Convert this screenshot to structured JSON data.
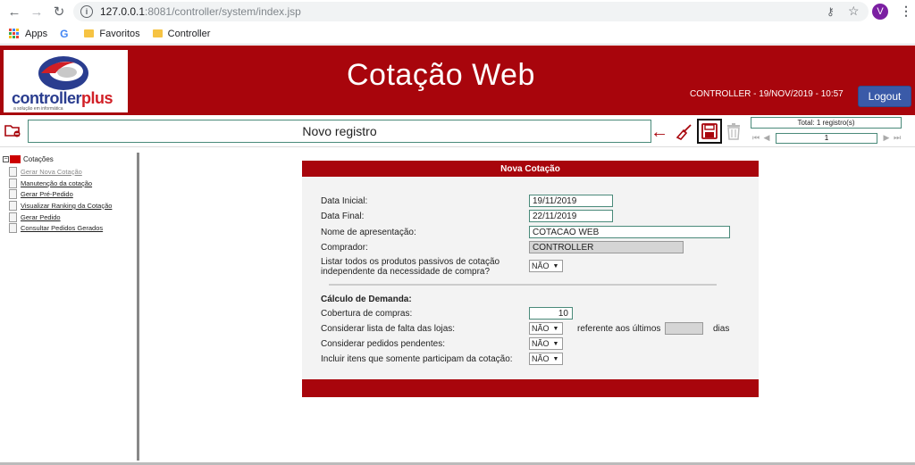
{
  "browser": {
    "url_host": "127.0.0.1",
    "url_path": ":8081/controller/system/index.jsp",
    "avatar_letter": "V",
    "bookmarks": [
      "Apps",
      "Favoritos",
      "Controller"
    ]
  },
  "header": {
    "logo_text_1": "controller",
    "logo_text_2": "plus",
    "logo_tagline": "a solução em informática",
    "title": "Cotação Web",
    "user_info": "CONTROLLER - 19/NOV/2019 - 10:57",
    "logout_label": "Logout",
    "brand_color": "#a8050c"
  },
  "toolbar": {
    "record_label": "Novo registro",
    "total_label": "Total: 1 registro(s)",
    "current_page": "1"
  },
  "sidebar": {
    "root_label": "Cotações",
    "items": [
      {
        "label": "Gerar Nova Cotação"
      },
      {
        "label": "Manutenção da cotação"
      },
      {
        "label": "Gerar Pré-Pedido"
      },
      {
        "label": "Visualizar Ranking da Cotação"
      },
      {
        "label": "Gerar Pedido"
      },
      {
        "label": "Consultar Pedidos Gerados"
      }
    ]
  },
  "form": {
    "title": "Nova Cotação",
    "data_inicial_label": "Data Inicial:",
    "data_inicial_value": "19/11/2019",
    "data_final_label": "Data Final:",
    "data_final_value": "22/11/2019",
    "nome_label": "Nome de apresentação:",
    "nome_value": "COTACAO WEB",
    "comprador_label": "Comprador:",
    "comprador_value": "CONTROLLER",
    "listar_label_1": "Listar todos os produtos passivos de cotação",
    "listar_label_2": "independente da necessidade de compra?",
    "listar_value": "NÃO",
    "demanda_title": "Cálculo de Demanda:",
    "cobertura_label": "Cobertura de compras:",
    "cobertura_value": "10",
    "falta_label": "Considerar lista de falta das lojas:",
    "falta_value": "NÃO",
    "referente_label": "referente aos últimos",
    "dias_label": "dias",
    "pendentes_label": "Considerar pedidos pendentes:",
    "pendentes_value": "NÃO",
    "incluir_label": "Incluir itens que somente participam da cotação:",
    "incluir_value": "NÃO"
  }
}
